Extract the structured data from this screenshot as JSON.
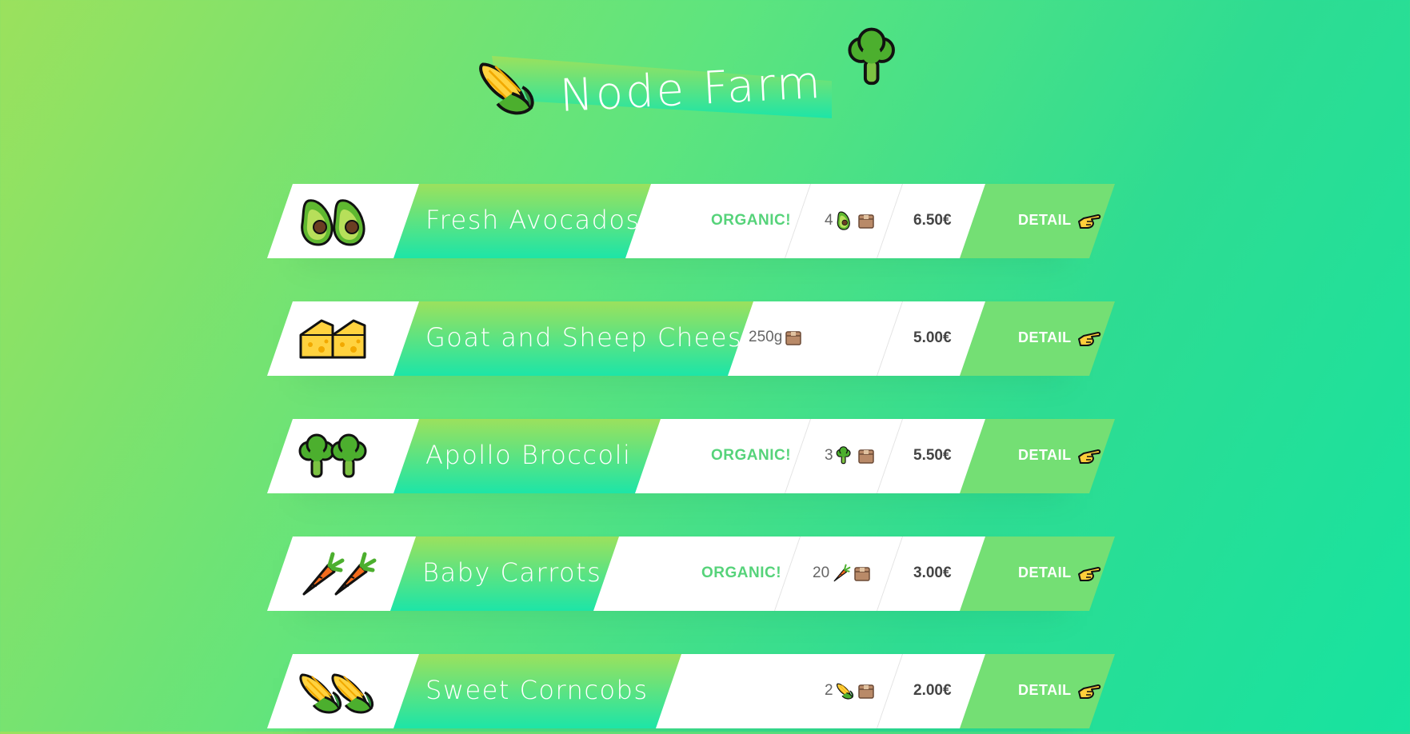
{
  "header": {
    "title": "Node Farm",
    "left_icon": "corn-icon",
    "right_icon": "broccoli-icon"
  },
  "colors": {
    "accent_green": "#74df74",
    "organic_text": "#56d37a",
    "gradient_top": "#9be15d",
    "gradient_bottom": "#1de5a7"
  },
  "products": [
    {
      "icon": "avocado-icon",
      "name": "Fresh Avocados",
      "organic": "ORGANIC!",
      "quantity": "4",
      "quantity_icon": "avocado-icon",
      "unit_icon": "box-icon",
      "price": "6.50€",
      "detail_label": "DETAIL"
    },
    {
      "icon": "cheese-icon",
      "name": "Goat and Sheep Cheese",
      "organic": "",
      "quantity": "250g",
      "quantity_icon": "",
      "unit_icon": "box-icon",
      "price": "5.00€",
      "detail_label": "DETAIL"
    },
    {
      "icon": "broccoli-icon",
      "name": "Apollo Broccoli",
      "organic": "ORGANIC!",
      "quantity": "3",
      "quantity_icon": "broccoli-icon",
      "unit_icon": "box-icon",
      "price": "5.50€",
      "detail_label": "DETAIL"
    },
    {
      "icon": "carrot-icon",
      "name": "Baby Carrots",
      "organic": "ORGANIC!",
      "quantity": "20",
      "quantity_icon": "carrot-icon",
      "unit_icon": "box-icon",
      "price": "3.00€",
      "detail_label": "DETAIL"
    },
    {
      "icon": "corn-icon",
      "name": "Sweet Corncobs",
      "organic": "",
      "quantity": "2",
      "quantity_icon": "corn-icon",
      "unit_icon": "box-icon",
      "price": "2.00€",
      "detail_label": "DETAIL"
    }
  ]
}
